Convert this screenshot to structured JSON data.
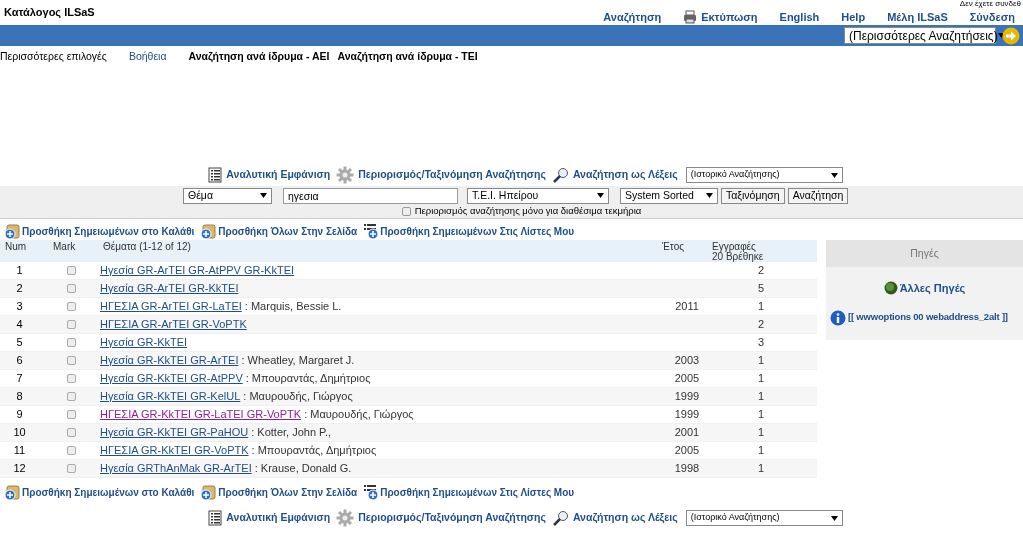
{
  "header": {
    "title": "Κατάλογος ILSaS",
    "login_status": "Δεν έχετε συνδεθ"
  },
  "nav": [
    {
      "label": "Αναζήτηση",
      "kind": "link"
    },
    {
      "label": "Εκτύπωση",
      "kind": "print"
    },
    {
      "label": "English",
      "kind": "link"
    },
    {
      "label": "Help",
      "kind": "link"
    },
    {
      "label": "Μέλη ILSaS",
      "kind": "link"
    },
    {
      "label": "Σύνδεση",
      "kind": "link"
    }
  ],
  "blue_bar": {
    "select": "(Περισσότερες Αναζητήσεις)"
  },
  "options": [
    {
      "label": "Περισσότερες επιλογές",
      "kind": "plain"
    },
    {
      "label": "Βοήθεια",
      "kind": "link"
    },
    {
      "label": "Αναζήτηση ανά ίδρυμα - ΑΕΙ",
      "kind": "plain"
    },
    {
      "label": "Αναζήτηση ανά ίδρυμα - ΤΕΙ",
      "kind": "plain"
    }
  ],
  "toolbars": [
    {
      "links": [
        {
          "label": "Αναλυτική Εμφάνιση",
          "kind": "list"
        },
        {
          "label": "Περιορισμός/Ταξινόμηση Αναζήτησης",
          "kind": "gear"
        },
        {
          "label": "Αναζήτηση ως Λέξεις",
          "kind": "magnifier"
        }
      ],
      "select": "(Ιστορικό Αναζήτησης)"
    },
    {
      "links": [
        {
          "label": "Αναλυτική Εμφάνιση",
          "kind": "list"
        },
        {
          "label": "Περιορισμός/Ταξινόμηση Αναζήτησης",
          "kind": "gear"
        },
        {
          "label": "Αναζήτηση ως Λέξεις",
          "kind": "magnifier"
        }
      ],
      "select": "(Ιστορικό Αναζήτησης)"
    }
  ],
  "search": {
    "field_select": "Θέμα",
    "query": "ηγεσια",
    "library_select": "Τ.Ε.Ι. Ηπείρου",
    "sort_select": "System Sorted",
    "buttons": [
      "Ταξινόμηση",
      "Αναζήτηση"
    ],
    "limit_checkbox": {
      "label": "Περιορισμός αναζήτησης μόνο για διαθέσιμα τεκμήρια",
      "checked": false
    }
  },
  "actions": [
    [
      {
        "label": "Προσθήκη Σημειωμένων στο Καλάθι",
        "kind": "bag"
      },
      {
        "label": "Προσθήκη Όλων Στην Σελίδα",
        "kind": "bag"
      },
      {
        "label": "Προσθήκη Σημειωμένων Στις Λίστες Μου",
        "kind": "list"
      }
    ],
    [
      {
        "label": "Προσθήκη Σημειωμένων στο Καλάθι",
        "kind": "bag"
      },
      {
        "label": "Προσθήκη Όλων Στην Σελίδα",
        "kind": "bag"
      },
      {
        "label": "Προσθήκη Σημειωμένων Στις Λίστες Μου",
        "kind": "list"
      }
    ]
  ],
  "table": {
    "columns": [
      "Num",
      "Mark",
      "Θέματα (1-12 of 12)",
      "Έτος",
      "Εγγραφές",
      "20 Βρέθηκε"
    ],
    "rows": [
      {
        "num": "1",
        "marked": false,
        "subject": "Ηγεσία GR-ArTEI GR-AtPPV GR-KkTEI",
        "visited": false,
        "count": "2"
      },
      {
        "num": "2",
        "marked": false,
        "subject": "Ηγεσία GR-ArTEI GR-KkTEI",
        "visited": false,
        "count": "5"
      },
      {
        "num": "3",
        "marked": false,
        "subject": "ΗΓΕΣΙΑ GR-ArTEI GR-LaTEI",
        "visited": false,
        "author": ": Marquis, Bessie L.",
        "year": "2011",
        "count": "1"
      },
      {
        "num": "4",
        "marked": false,
        "subject": "ΗΓΕΣΙΑ GR-ArTEI GR-VoPTK",
        "visited": false,
        "count": "2"
      },
      {
        "num": "5",
        "marked": false,
        "subject": "Ηγεσία GR-KkTEI",
        "visited": false,
        "count": "3"
      },
      {
        "num": "6",
        "marked": false,
        "subject": "Ηγεσία GR-KkTEI GR-ArTEI",
        "visited": false,
        "author": ": Wheatley, Margaret J.",
        "year": "2003",
        "count": "1"
      },
      {
        "num": "7",
        "marked": false,
        "subject": "Ηγεσία GR-KkTEI GR-AtPPV",
        "visited": false,
        "author": ": Μπουραντάς, Δημήτριος",
        "year": "2005",
        "count": "1"
      },
      {
        "num": "8",
        "marked": false,
        "subject": "Ηγεσία GR-KkTEI GR-KelUL",
        "visited": false,
        "author": ": Μαυρουδής, Γιώργος",
        "year": "1999",
        "count": "1"
      },
      {
        "num": "9",
        "marked": false,
        "subject": "ΗΓΕΣΙΑ GR-KkTEI GR-LaTEI GR-VoPTK",
        "visited": true,
        "author": ": Μαυρουδής, Γιώργος",
        "year": "1999",
        "count": "1"
      },
      {
        "num": "10",
        "marked": false,
        "subject": "Ηγεσία GR-KkTEI GR-PaHOU",
        "visited": false,
        "author": ": Kotter, John P.,",
        "year": "2001",
        "count": "1"
      },
      {
        "num": "11",
        "marked": false,
        "subject": "ΗΓΕΣΙΑ GR-KkTEI GR-VoPTK",
        "visited": false,
        "author": ": Μπουραντάς, Δημήτριος",
        "year": "2005",
        "count": "1"
      },
      {
        "num": "12",
        "marked": false,
        "subject": "Ηγεσία GRThAnMak GR-ArTEI",
        "visited": false,
        "author": ": Krause, Donald G.",
        "year": "1998",
        "count": "1"
      }
    ]
  },
  "sources": {
    "title": "Πηγές",
    "other_sources": "Άλλες Πηγές",
    "info_link": "[[ wwwoptions 00 webaddress_2alt ]]"
  }
}
